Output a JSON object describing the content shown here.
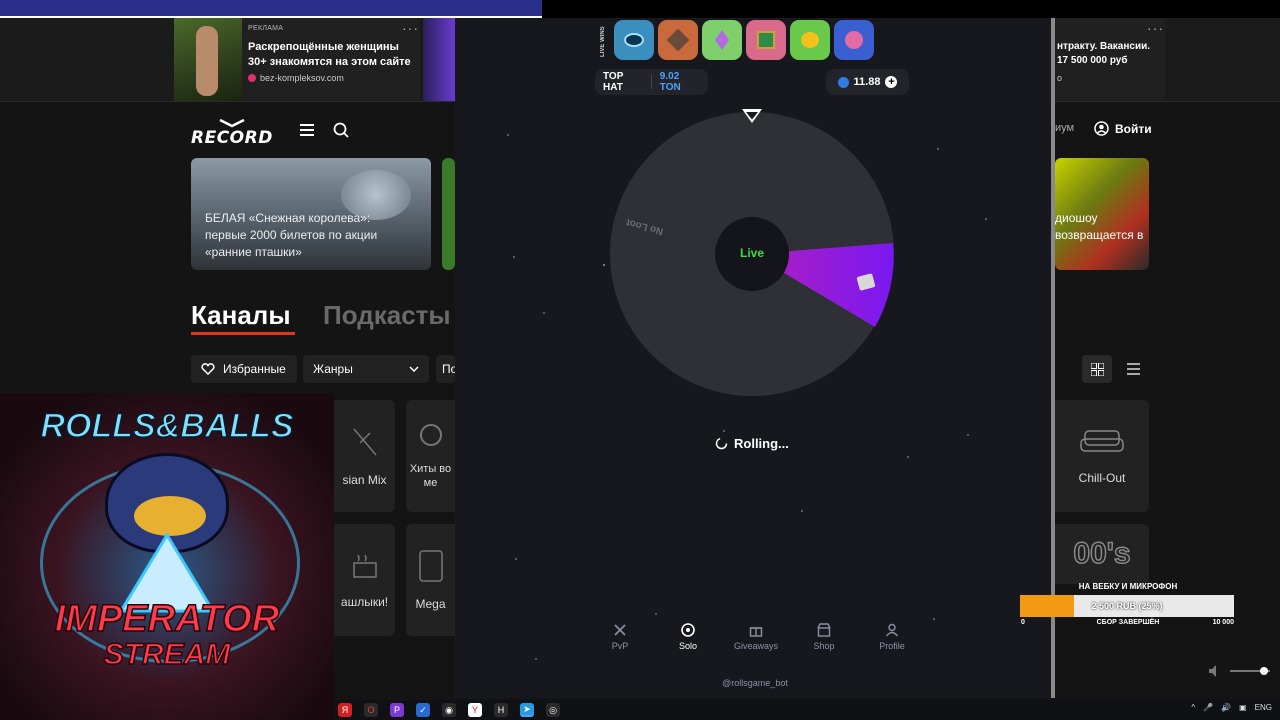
{
  "ads": {
    "ad1": {
      "tag": "РЕКЛАМА",
      "title": "Раскрепощённые женщины 30+ знакомятся на этом сайте",
      "source": "bez-kompleksov.com",
      "more": "···"
    },
    "ad2": {
      "title": "нтракту. Вакансии. 17 500 000 руб",
      "extra": "о",
      "more": "···"
    }
  },
  "site": {
    "logo": "RECORD",
    "login_label": "Войти",
    "premium_partial": "иум",
    "hero_card_text": "БЕЛАЯ «Снежная королева»: первые 2000 билетов по акции «ранние пташки»",
    "right_card_text": "диошоу возвращается в",
    "tab_channels": "Каналы",
    "tab_podcasts": "Подкасты",
    "fav_label": "Избранные",
    "genres_label": "Жанры",
    "partial_filter": "По",
    "tiles": {
      "asian_mix": "sian Mix",
      "hits": "Хиты во ме",
      "shashlyki": "ашлыки!",
      "mega": "Mega",
      "chill_out": "Chill-Out",
      "zeros": "00's"
    }
  },
  "game": {
    "live_wins_label": "LIVE WINS",
    "gift_icons": [
      "blue-orb-icon",
      "brown-cube-icon",
      "crystal-icon",
      "green-chest-icon",
      "duck-icon",
      "pink-creature-icon"
    ],
    "top_hat_label": "TOP HAT",
    "top_hat_value": "9.02 TON",
    "balance": "11.88",
    "wheel_segment_no_loot": "No Loot",
    "wheel_center": "Live",
    "status": "Rolling...",
    "nav": [
      {
        "label": "PvP",
        "icon": "swords-icon"
      },
      {
        "label": "Solo",
        "icon": "wheel-icon"
      },
      {
        "label": "Giveaways",
        "icon": "gift-icon"
      },
      {
        "label": "Shop",
        "icon": "shop-icon"
      },
      {
        "label": "Profile",
        "icon": "user-icon"
      }
    ],
    "bot_handle": "@rollsgame_bot"
  },
  "stream": {
    "cover_title_1": "ROLLS&BALLS",
    "cover_title_2": "IMPERATOR",
    "cover_title_3": "STREAM",
    "donation_goal_label": "НА ВЕБКУ И МИКРОФОН",
    "donation_amount": "2 500 RUB (25%)",
    "donation_progress": 0.25,
    "donation_min": "0",
    "donation_status": "СБОР ЗАВЕРШЁН",
    "donation_max": "10 000"
  },
  "taskbar": {
    "lang": "ENG"
  },
  "colors": {
    "accent_purple": "#8a2be2",
    "live_green": "#3ddc3d",
    "ton_blue": "#4aa3ff",
    "donation_orange": "#f39a12"
  }
}
